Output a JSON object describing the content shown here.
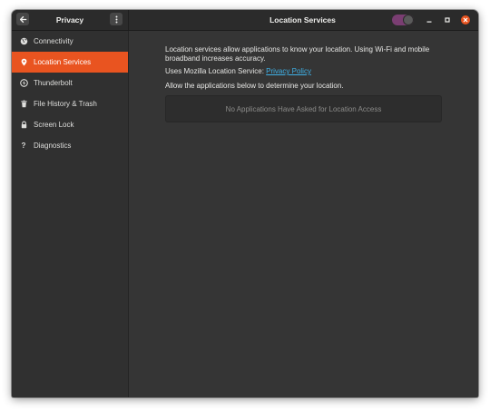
{
  "header": {
    "panel_title": "Privacy",
    "page_title": "Location Services",
    "location_toggle": {
      "state": "on",
      "color": "#7a3e72"
    },
    "icons": {
      "back": "arrow-left-icon",
      "menu": "vertical-ellipsis-icon",
      "minimize": "minimize-icon",
      "maximize": "maximize-icon",
      "close": "close-icon"
    }
  },
  "sidebar": {
    "accent": "#e95420",
    "items": [
      {
        "label": "Connectivity",
        "icon": "globe-icon",
        "selected": false
      },
      {
        "label": "Location Services",
        "icon": "location-pin-icon",
        "selected": true
      },
      {
        "label": "Thunderbolt",
        "icon": "thunderbolt-icon",
        "selected": false
      },
      {
        "label": "File History & Trash",
        "icon": "trash-icon",
        "selected": false
      },
      {
        "label": "Screen Lock",
        "icon": "lock-icon",
        "selected": false
      },
      {
        "label": "Diagnostics",
        "icon": "question-icon",
        "selected": false
      }
    ]
  },
  "content": {
    "description_line1": "Location services allow applications to know your location. Using Wi-Fi and mobile",
    "description_line2": "broadband increases accuracy.",
    "uses_prefix": "Uses Mozilla Location Service: ",
    "privacy_link": "Privacy Policy",
    "allow_text": "Allow the applications below to determine your location.",
    "empty_apps_text": "No Applications Have Asked for Location Access"
  }
}
